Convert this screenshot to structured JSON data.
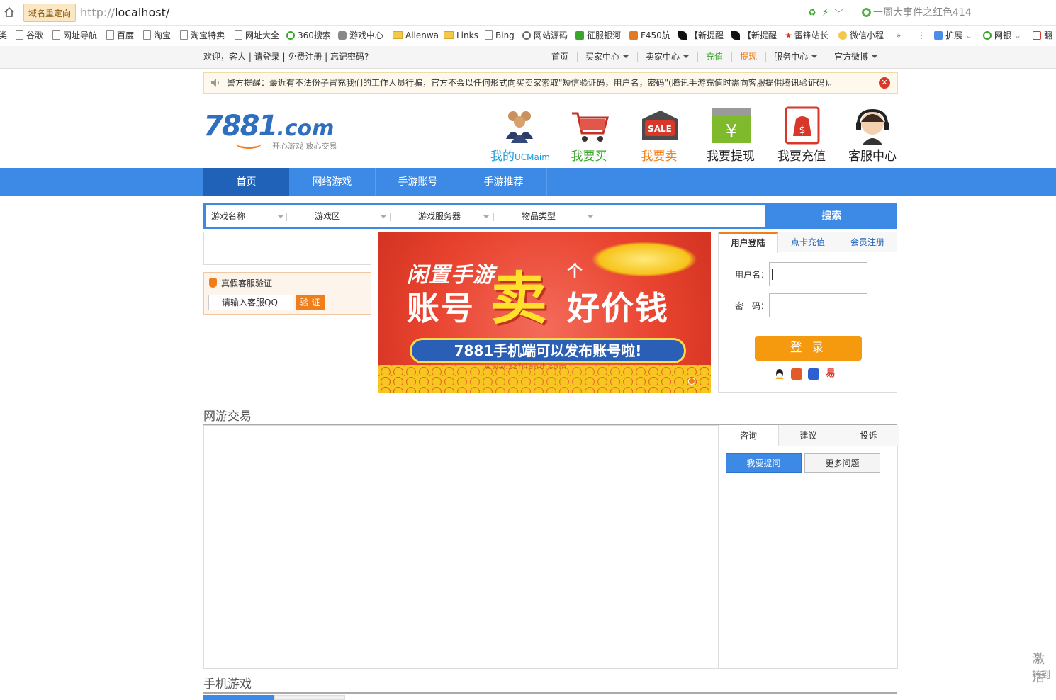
{
  "browser": {
    "redirect_badge": "域名重定向",
    "url_prefix": "http://",
    "url_host": "localhost/",
    "search_hint": "一周大事件之红色414",
    "bookmarks": [
      "类",
      "谷歌",
      "网址导航",
      "百度",
      "淘宝",
      "淘宝特卖",
      "网址大全",
      "360搜索",
      "游戏中心",
      "Alienwa",
      "Links",
      "Bing",
      "网站源码",
      "征服银河",
      "F450航",
      "【新提醒",
      "【新提醒",
      "雷锋站长",
      "微信小程",
      "»",
      "⋮",
      "扩展",
      "网银",
      "翻"
    ]
  },
  "topbar": {
    "welcome": "欢迎，客人 | 请登录 | 免费注册 | 忘记密码?",
    "nav": [
      {
        "label": "首页",
        "caret": false,
        "color": "#333333"
      },
      {
        "label": "买家中心",
        "caret": true,
        "color": "#333333"
      },
      {
        "label": "卖家中心",
        "caret": true,
        "color": "#333333"
      },
      {
        "label": "充值",
        "caret": false,
        "color": "#3aa52b"
      },
      {
        "label": "提现",
        "caret": false,
        "color": "#f07f1b"
      },
      {
        "label": "服务中心",
        "caret": true,
        "color": "#333333"
      },
      {
        "label": "官方微博",
        "caret": true,
        "color": "#333333"
      }
    ]
  },
  "notice": {
    "text": "警方提醒：最近有不法份子冒充我们的工作人员行骗，官方不会以任何形式向买卖家索取\"短信验证码，用户名，密码\"(腾讯手游充值时需向客服提供腾讯验证码)。"
  },
  "logo": {
    "main": "7881",
    "suffix": ".com",
    "slogan": "开心游戏 放心交易"
  },
  "quick_links": [
    {
      "label": "我的",
      "extra": "UCMaim",
      "icon": "people-icon",
      "color": "#1a9ad6"
    },
    {
      "label": "我要买",
      "extra": "",
      "icon": "cart-icon",
      "color": "#3aa52b"
    },
    {
      "label": "我要卖",
      "extra": "",
      "icon": "sale-icon",
      "color": "#f07f1b"
    },
    {
      "label": "我要提现",
      "extra": "",
      "icon": "withdraw-icon",
      "color": "#222222"
    },
    {
      "label": "我要充值",
      "extra": "",
      "icon": "moneybag-icon",
      "color": "#222222"
    },
    {
      "label": "客服中心",
      "extra": "",
      "icon": "headset-icon",
      "color": "#222222"
    }
  ],
  "mainnav": [
    "首页",
    "网络游戏",
    "手游账号",
    "手游推荐"
  ],
  "search": {
    "fields": [
      "游戏名称",
      "游戏区",
      "游戏服务器",
      "物品类型"
    ],
    "button": "搜索"
  },
  "verify": {
    "title": "真假客服验证",
    "placeholder": "请输入客服QQ",
    "button": "验 证"
  },
  "banner": {
    "line1": "闲置手游",
    "line2": "账号",
    "sell": "卖",
    "ge": "个",
    "line3": "好价钱",
    "pill": "7881手机端可以发布账号啦!",
    "watermark": "www.zzfriend.com"
  },
  "login": {
    "tabs": [
      "用户登陆",
      "点卡充值",
      "会员注册"
    ],
    "username_label": "用户名：",
    "password_label": "密　码：",
    "button": "登 录"
  },
  "sections": {
    "online": "网游交易",
    "mobile": "手机游戏"
  },
  "qa": {
    "tabs": [
      "咨询",
      "建议",
      "投诉"
    ],
    "ask": "我要提问",
    "more": "更多问题"
  },
  "watermark_os": {
    "line1": "激活",
    "line2": "转到"
  }
}
